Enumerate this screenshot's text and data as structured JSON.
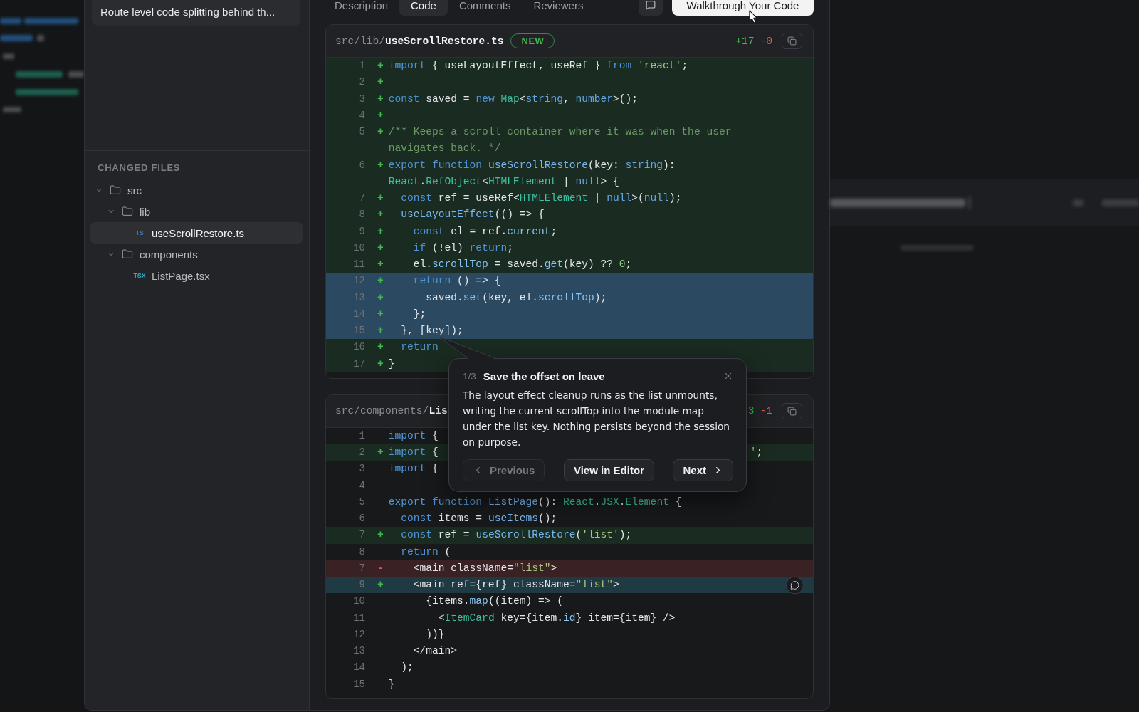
{
  "sidebar": {
    "request_card": {
      "title": "Route level code splitting behind th..."
    },
    "changed_files": {
      "heading": "CHANGED FILES",
      "tree": [
        {
          "name": "src",
          "kind": "folder",
          "expanded": true,
          "selected": false,
          "children": [
            {
              "name": "lib",
              "kind": "folder",
              "expanded": true,
              "selected": false,
              "children": [
                {
                  "name": "useScrollRestore.ts",
                  "kind": "file",
                  "badge": "TS",
                  "color": "#3a80d0",
                  "selected": true
                }
              ]
            },
            {
              "name": "components",
              "kind": "folder",
              "expanded": true,
              "selected": false,
              "children": [
                {
                  "name": "ListPage.tsx",
                  "kind": "file",
                  "badge": "TSX",
                  "color": "#2fb0c0",
                  "selected": false
                }
              ]
            }
          ]
        }
      ]
    }
  },
  "tabs": [
    {
      "label": "Description",
      "selected": false
    },
    {
      "label": "Code",
      "selected": true
    },
    {
      "label": "Comments",
      "selected": false
    },
    {
      "label": "Reviewers",
      "selected": false
    }
  ],
  "walkthrough_button": {
    "label": "Walkthrough Your Code"
  },
  "files": [
    {
      "path": "src/lib/**useScrollRestore.ts**",
      "badge": "NEW",
      "additions": "+17",
      "deletions": "-0",
      "lines": [
        {
          "number": "1",
          "sign": "+",
          "kind": "added",
          "highlighted": false,
          "hovered": false,
          "tokens": [
            {
              "text": "import",
              "kind": "keyword"
            },
            {
              "text": " { useLayoutEffect, useRef } ",
              "kind": "plain"
            },
            {
              "text": "from ",
              "kind": "keyword"
            },
            {
              "text": "'react'",
              "kind": "string"
            },
            {
              "text": ";",
              "kind": "plain"
            }
          ]
        },
        {
          "number": "2",
          "sign": "+",
          "kind": "added",
          "highlighted": false,
          "hovered": false
        },
        {
          "number": "3",
          "sign": "+",
          "kind": "added",
          "highlighted": false,
          "hovered": false,
          "tokens": [
            {
              "text": "const",
              "kind": "keyword"
            },
            {
              "text": " saved = ",
              "kind": "plain"
            },
            {
              "text": "new ",
              "kind": "keyword"
            },
            {
              "text": "Map",
              "kind": "type"
            },
            {
              "text": "<",
              "kind": "plain"
            },
            {
              "text": "string",
              "kind": "primitive"
            },
            {
              "text": ", ",
              "kind": "plain"
            },
            {
              "text": "number",
              "kind": "primitive"
            },
            {
              "text": ">();",
              "kind": "plain"
            }
          ]
        },
        {
          "number": "4",
          "sign": "+",
          "kind": "added",
          "highlighted": false,
          "hovered": false
        },
        {
          "number": "5",
          "sign": "+",
          "kind": "added",
          "highlighted": false,
          "hovered": false,
          "tokens": [
            {
              "text": "/** Keeps a scroll container where it was when the user navigates back. */",
              "kind": "comment"
            }
          ]
        },
        {
          "number": "6",
          "sign": "+",
          "kind": "added",
          "highlighted": false,
          "hovered": false,
          "tokens": [
            {
              "text": "export ",
              "kind": "keyword"
            },
            {
              "text": "function ",
              "kind": "keyword"
            },
            {
              "text": "useScrollRestore",
              "kind": "function"
            },
            {
              "text": "(key: ",
              "kind": "plain"
            },
            {
              "text": "string",
              "kind": "primitive"
            },
            {
              "text": "): ",
              "kind": "plain"
            },
            {
              "text": "React",
              "kind": "type"
            },
            {
              "text": ".",
              "kind": "plain"
            },
            {
              "text": "RefObject",
              "kind": "type"
            },
            {
              "text": "<",
              "kind": "plain"
            },
            {
              "text": "HTMLElement",
              "kind": "type"
            },
            {
              "text": " | ",
              "kind": "plain"
            },
            {
              "text": "null",
              "kind": "primitive"
            },
            {
              "text": "> {",
              "kind": "plain"
            }
          ]
        },
        {
          "number": "7",
          "sign": "+",
          "kind": "added",
          "highlighted": false,
          "hovered": false,
          "tokens": [
            {
              "text": "  const",
              "kind": "keyword"
            },
            {
              "text": " ref = useRef<",
              "kind": "plain"
            },
            {
              "text": "HTMLElement",
              "kind": "type"
            },
            {
              "text": " | ",
              "kind": "plain"
            },
            {
              "text": "null",
              "kind": "primitive"
            },
            {
              "text": ">(",
              "kind": "plain"
            },
            {
              "text": "null",
              "kind": "primitive"
            },
            {
              "text": ");",
              "kind": "plain"
            }
          ]
        },
        {
          "number": "8",
          "sign": "+",
          "kind": "added",
          "highlighted": false,
          "hovered": false,
          "tokens": [
            {
              "text": "  useLayoutEffect",
              "kind": "function"
            },
            {
              "text": "(() => {",
              "kind": "plain"
            }
          ]
        },
        {
          "number": "9",
          "sign": "+",
          "kind": "added",
          "highlighted": false,
          "hovered": false,
          "tokens": [
            {
              "text": "    const",
              "kind": "keyword"
            },
            {
              "text": " el = ref.",
              "kind": "plain"
            },
            {
              "text": "current",
              "kind": "property"
            },
            {
              "text": ";",
              "kind": "plain"
            }
          ]
        },
        {
          "number": "10",
          "sign": "+",
          "kind": "added",
          "highlighted": false,
          "hovered": false,
          "tokens": [
            {
              "text": "    if",
              "kind": "keyword"
            },
            {
              "text": " (!el) ",
              "kind": "plain"
            },
            {
              "text": "return",
              "kind": "keyword"
            },
            {
              "text": ";",
              "kind": "plain"
            }
          ]
        },
        {
          "number": "11",
          "sign": "+",
          "kind": "added",
          "highlighted": false,
          "hovered": false,
          "tokens": [
            {
              "text": "    el.",
              "kind": "plain"
            },
            {
              "text": "scrollTop",
              "kind": "property"
            },
            {
              "text": " = saved.",
              "kind": "plain"
            },
            {
              "text": "get",
              "kind": "property"
            },
            {
              "text": "(key) ?? ",
              "kind": "plain"
            },
            {
              "text": "0",
              "kind": "number"
            },
            {
              "text": ";",
              "kind": "plain"
            }
          ]
        },
        {
          "number": "12",
          "sign": "+",
          "kind": "added",
          "highlighted": true,
          "hovered": false,
          "tokens": [
            {
              "text": "    return",
              "kind": "keyword"
            },
            {
              "text": " () => {",
              "kind": "plain"
            }
          ]
        },
        {
          "number": "13",
          "sign": "+",
          "kind": "added",
          "highlighted": true,
          "hovered": false,
          "tokens": [
            {
              "text": "      saved.",
              "kind": "plain"
            },
            {
              "text": "set",
              "kind": "property"
            },
            {
              "text": "(key, el.",
              "kind": "plain"
            },
            {
              "text": "scrollTop",
              "kind": "property"
            },
            {
              "text": ");",
              "kind": "plain"
            }
          ]
        },
        {
          "number": "14",
          "sign": "+",
          "kind": "added",
          "highlighted": true,
          "hovered": false,
          "tokens": [
            {
              "text": "    };",
              "kind": "plain"
            }
          ]
        },
        {
          "number": "15",
          "sign": "+",
          "kind": "added",
          "highlighted": true,
          "hovered": false,
          "tokens": [
            {
              "text": "  }, [key]);",
              "kind": "plain"
            }
          ]
        },
        {
          "number": "16",
          "sign": "+",
          "kind": "added",
          "highlighted": false,
          "hovered": false,
          "tokens": [
            {
              "text": "  return",
              "kind": "keyword"
            }
          ]
        },
        {
          "number": "17",
          "sign": "+",
          "kind": "added",
          "highlighted": false,
          "hovered": false,
          "tokens": [
            {
              "text": "}",
              "kind": "plain"
            }
          ]
        }
      ]
    },
    {
      "path": "src/components/**Lis**",
      "additions": "3",
      "deletions": "-1",
      "lines": [
        {
          "number": "1",
          "kind": "unchanged",
          "highlighted": false,
          "hovered": false,
          "tokens": [
            {
              "text": "import",
              "kind": "keyword"
            },
            {
              "text": " {",
              "kind": "plain"
            }
          ]
        },
        {
          "number": "2",
          "sign": "+",
          "kind": "added",
          "highlighted": false,
          "hovered": false,
          "tokens": [
            {
              "text": "import",
              "kind": "keyword"
            },
            {
              "text": " {",
              "kind": "plain"
            }
          ],
          "right_fragment": [
            {
              "text": "'",
              "kind": "string"
            },
            {
              "text": ";",
              "kind": "plain"
            }
          ]
        },
        {
          "number": "3",
          "kind": "unchanged",
          "highlighted": false,
          "hovered": false,
          "tokens": [
            {
              "text": "import",
              "kind": "keyword"
            },
            {
              "text": " {",
              "kind": "plain"
            }
          ]
        },
        {
          "number": "4",
          "kind": "unchanged",
          "highlighted": false,
          "hovered": false
        },
        {
          "number": "5",
          "kind": "unchanged",
          "highlighted": false,
          "hovered": false,
          "tokens": [
            {
              "text": "export ",
              "kind": "keyword"
            },
            {
              "text": "function ",
              "kind": "keyword"
            },
            {
              "text": "ListPage",
              "kind": "function"
            },
            {
              "text": "(): ",
              "kind": "plain"
            },
            {
              "text": "React",
              "kind": "type"
            },
            {
              "text": ".",
              "kind": "plain"
            },
            {
              "text": "JSX",
              "kind": "type"
            },
            {
              "text": ".",
              "kind": "plain"
            },
            {
              "text": "Element",
              "kind": "type"
            },
            {
              "text": " {",
              "kind": "plain"
            }
          ]
        },
        {
          "number": "6",
          "kind": "unchanged",
          "highlighted": false,
          "hovered": false,
          "tokens": [
            {
              "text": "  const",
              "kind": "keyword"
            },
            {
              "text": " items = ",
              "kind": "plain"
            },
            {
              "text": "useItems",
              "kind": "function"
            },
            {
              "text": "();",
              "kind": "plain"
            }
          ]
        },
        {
          "number": "7",
          "sign": "+",
          "kind": "added",
          "highlighted": false,
          "hovered": false,
          "tokens": [
            {
              "text": "  const",
              "kind": "keyword"
            },
            {
              "text": " ref = ",
              "kind": "plain"
            },
            {
              "text": "useScrollRestore",
              "kind": "function"
            },
            {
              "text": "(",
              "kind": "plain"
            },
            {
              "text": "'list'",
              "kind": "string"
            },
            {
              "text": ");",
              "kind": "plain"
            }
          ]
        },
        {
          "number": "8",
          "kind": "unchanged",
          "highlighted": false,
          "hovered": false,
          "tokens": [
            {
              "text": "  return",
              "kind": "keyword"
            },
            {
              "text": " (",
              "kind": "plain"
            }
          ]
        },
        {
          "number": "7",
          "sign": "-",
          "kind": "removed",
          "highlighted": false,
          "hovered": false,
          "tokens": [
            {
              "text": "    <main className=",
              "kind": "plain"
            },
            {
              "text": "\"list\"",
              "kind": "string"
            },
            {
              "text": ">",
              "kind": "plain"
            }
          ]
        },
        {
          "number": "9",
          "sign": "+",
          "kind": "added",
          "highlighted": false,
          "hovered": true,
          "tokens": [
            {
              "text": "    <main ref={ref} className=",
              "kind": "plain"
            },
            {
              "text": "\"list\"",
              "kind": "string"
            },
            {
              "text": ">",
              "kind": "plain"
            }
          ]
        },
        {
          "number": "10",
          "kind": "unchanged",
          "highlighted": false,
          "hovered": false,
          "tokens": [
            {
              "text": "      {items.",
              "kind": "plain"
            },
            {
              "text": "map",
              "kind": "property"
            },
            {
              "text": "((item) => (",
              "kind": "plain"
            }
          ]
        },
        {
          "number": "11",
          "kind": "unchanged",
          "highlighted": false,
          "hovered": false,
          "tokens": [
            {
              "text": "        <",
              "kind": "plain"
            },
            {
              "text": "ItemCard",
              "kind": "type"
            },
            {
              "text": " key={item.",
              "kind": "plain"
            },
            {
              "text": "id",
              "kind": "property"
            },
            {
              "text": "} item={item} />",
              "kind": "plain"
            }
          ]
        },
        {
          "number": "12",
          "kind": "unchanged",
          "highlighted": false,
          "hovered": false,
          "tokens": [
            {
              "text": "      ))}",
              "kind": "plain"
            }
          ]
        },
        {
          "number": "13",
          "kind": "unchanged",
          "highlighted": false,
          "hovered": false,
          "tokens": [
            {
              "text": "    </main>",
              "kind": "plain"
            }
          ]
        },
        {
          "number": "14",
          "kind": "unchanged",
          "highlighted": false,
          "hovered": false,
          "tokens": [
            {
              "text": "  );",
              "kind": "plain"
            }
          ]
        },
        {
          "number": "15",
          "kind": "unchanged",
          "highlighted": false,
          "hovered": false,
          "tokens": [
            {
              "text": "}",
              "kind": "plain"
            }
          ]
        }
      ]
    }
  ],
  "walkthrough_popover": {
    "step": "1/3",
    "title": "Save the offset on leave",
    "body": "The layout effect cleanup runs as the list unmounts, writing the current scrollTop into the module map under the list key. Nothing persists beyond the session on purpose.",
    "buttons": [
      {
        "label": "Previous",
        "kind": "previous",
        "disabled": true
      },
      {
        "label": "View in Editor",
        "kind": "open",
        "disabled": false
      },
      {
        "label": "Next",
        "kind": "next",
        "disabled": false
      }
    ]
  }
}
